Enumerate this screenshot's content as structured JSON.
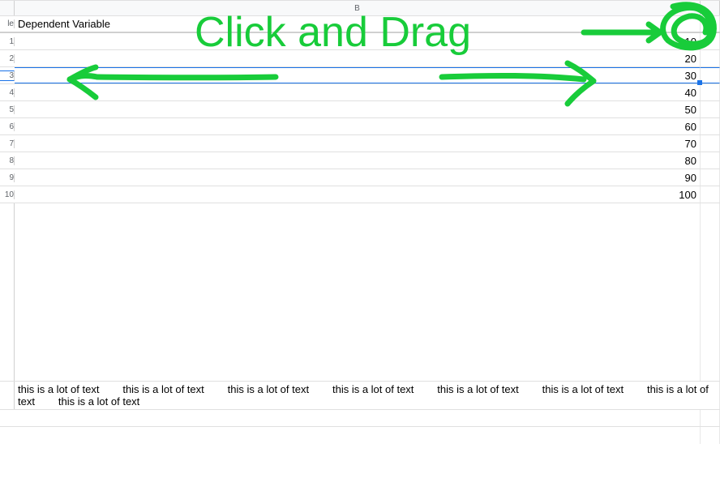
{
  "columns": {
    "partialA_label": "le",
    "B_label": "B"
  },
  "header_row": {
    "colB": "Dependent Variable"
  },
  "rows": [
    {
      "n": "1",
      "val": "10"
    },
    {
      "n": "2",
      "val": "20"
    },
    {
      "n": "3",
      "val": "30"
    },
    {
      "n": "4",
      "val": "40"
    },
    {
      "n": "5",
      "val": "50"
    },
    {
      "n": "6",
      "val": "60"
    },
    {
      "n": "7",
      "val": "70"
    },
    {
      "n": "8",
      "val": "80"
    },
    {
      "n": "9",
      "val": "90"
    },
    {
      "n": "10",
      "val": "100"
    }
  ],
  "selected_row_index": 2,
  "long_text": "this is a lot of text        this is a lot of text        this is a lot of text        this is a lot of text        this is a lot of text        this is a lot of text        this is a lot of text        this is a lot of text",
  "annotation": {
    "text": "Click and Drag",
    "color": "#18cc3a"
  }
}
